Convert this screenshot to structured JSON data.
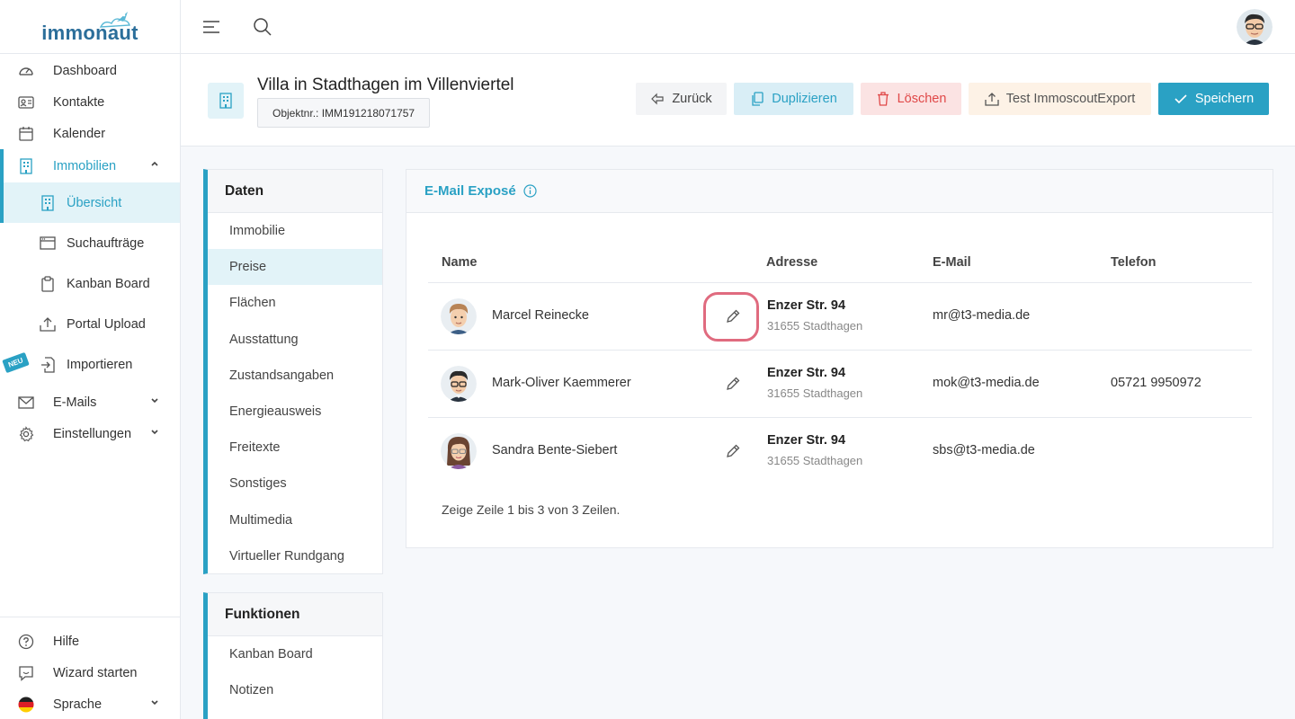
{
  "brand": {
    "name_a": "immo",
    "name_b": "naut"
  },
  "sidebar": {
    "items": [
      {
        "label": "Dashboard"
      },
      {
        "label": "Kontakte"
      },
      {
        "label": "Kalender"
      },
      {
        "label": "Immobilien"
      }
    ],
    "sub_items": [
      {
        "label": "Übersicht"
      },
      {
        "label": "Suchaufträge"
      },
      {
        "label": "Kanban Board"
      },
      {
        "label": "Portal Upload"
      },
      {
        "label": "Importieren"
      }
    ],
    "items2": [
      {
        "label": "E-Mails"
      },
      {
        "label": "Einstellungen"
      }
    ],
    "badge_new": "NEU",
    "bottom": [
      {
        "label": "Hilfe"
      },
      {
        "label": "Wizard starten"
      },
      {
        "label": "Sprache"
      }
    ]
  },
  "header": {
    "title": "Villa in Stadthagen im Villenviertel",
    "object_nr": "Objektnr.: IMM191218071757",
    "buttons": {
      "back": "Zurück",
      "duplicate": "Duplizieren",
      "delete": "Löschen",
      "export": "Test ImmoscoutExport",
      "save": "Speichern"
    }
  },
  "menu_daten": {
    "title": "Daten",
    "items": [
      "Immobilie",
      "Preise",
      "Flächen",
      "Ausstattung",
      "Zustandsangaben",
      "Energieausweis",
      "Freitexte",
      "Sonstiges",
      "Multimedia",
      "Virtueller Rundgang"
    ],
    "active_index": 1
  },
  "menu_funktionen": {
    "title": "Funktionen",
    "items": [
      "Kanban Board",
      "Notizen"
    ]
  },
  "panel": {
    "title": "E-Mail Exposé",
    "columns": {
      "name": "Name",
      "address": "Adresse",
      "email": "E-Mail",
      "phone": "Telefon"
    },
    "rows": [
      {
        "name": "Marcel Reinecke",
        "street": "Enzer Str. 94",
        "city": "31655 Stadthagen",
        "email": "mr@t3-media.de",
        "phone": ""
      },
      {
        "name": "Mark-Oliver Kaemmerer",
        "street": "Enzer Str. 94",
        "city": "31655 Stadthagen",
        "email": "mok@t3-media.de",
        "phone": "05721 9950972"
      },
      {
        "name": "Sandra Bente-Siebert",
        "street": "Enzer Str. 94",
        "city": "31655 Stadthagen",
        "email": "sbs@t3-media.de",
        "phone": ""
      }
    ],
    "footer": "Zeige Zeile 1 bis 3 von 3 Zeilen."
  },
  "colors": {
    "accent": "#2aa1c4",
    "danger": "#e04848",
    "highlight": "#e06b7f"
  }
}
